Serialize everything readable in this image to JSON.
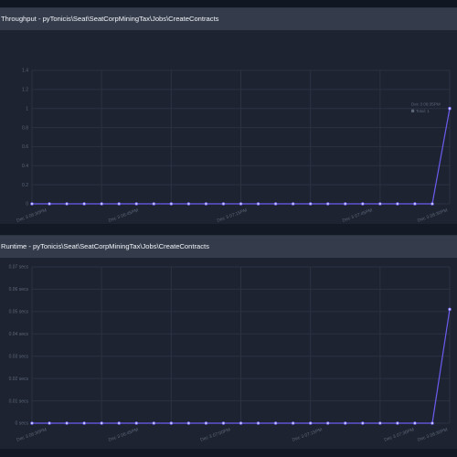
{
  "panels": [
    {
      "title": "Throughput - pyTonicis\\Seat\\SeatCorpMiningTax\\Jobs\\CreateContracts",
      "chart_data": {
        "type": "line",
        "ytick_labels": [
          "0",
          "0.2",
          "0.4",
          "0.6",
          "0.8",
          "1",
          "1.2",
          "1.4"
        ],
        "ylim": [
          0,
          1.4
        ],
        "xtick_labels": [
          "Dec 3 06:30PM",
          "Dec 3 06:45PM",
          "Dec 3 07:15PM",
          "Dec 3 07:45PM",
          "Dec 3 08:30PM"
        ],
        "legend_date": "Dec 3 08:35PM",
        "legend_text": "Total: 1",
        "series": [
          {
            "name": "Total",
            "color": "#6b5cf0",
            "values": [
              0,
              0,
              0,
              0,
              0,
              0,
              0,
              0,
              0,
              0,
              0,
              0,
              0,
              0,
              0,
              0,
              0,
              0,
              0,
              0,
              0,
              0,
              0,
              0,
              1
            ]
          }
        ]
      }
    },
    {
      "title": "Runtime - pyTonicis\\Seat\\SeatCorpMiningTax\\Jobs\\CreateContracts",
      "chart_data": {
        "type": "line",
        "ytick_labels": [
          "0 secs",
          "0.01 secs",
          "0.02 secs",
          "0.03 secs",
          "0.04 secs",
          "0.05 secs",
          "0.06 secs",
          "0.07 secs"
        ],
        "ylim": [
          0,
          0.07
        ],
        "xtick_labels": [
          "Dec 3 06:30PM",
          "Dec 3 06:45PM",
          "Dec 3 07:00PM",
          "Dec 3 07:15PM",
          "Dec 3 07:30PM",
          "Dec 3 08:30PM"
        ],
        "series": [
          {
            "name": "Runtime",
            "color": "#6b5cf0",
            "values": [
              0,
              0,
              0,
              0,
              0,
              0,
              0,
              0,
              0,
              0,
              0,
              0,
              0,
              0,
              0,
              0,
              0,
              0,
              0,
              0,
              0,
              0,
              0,
              0,
              0.051
            ]
          }
        ]
      }
    }
  ]
}
